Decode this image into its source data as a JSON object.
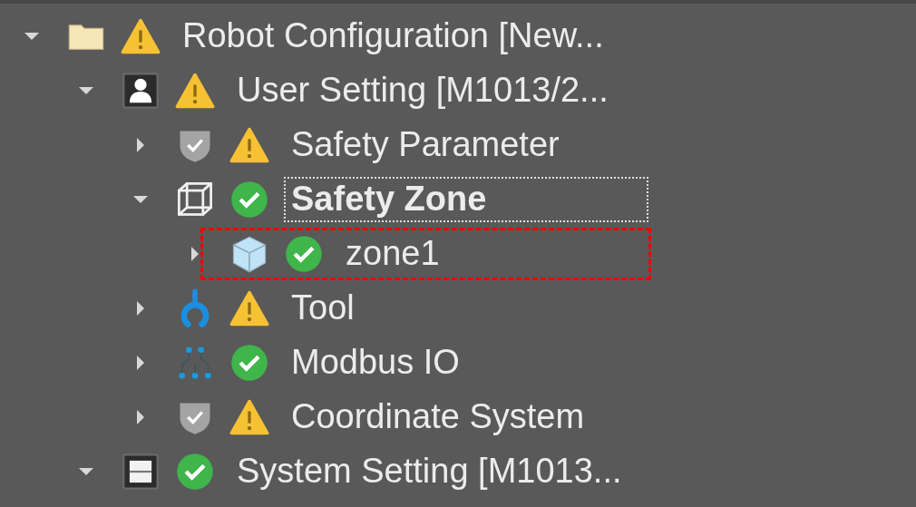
{
  "tree": [
    {
      "label": "Robot Configuration [New...",
      "kind": "folder",
      "warning": true,
      "expanded": true,
      "selected": false,
      "marked": false,
      "children": [
        {
          "label": "User Setting [M1013/2...",
          "kind": "user",
          "warning": true,
          "expanded": true,
          "selected": false,
          "marked": false,
          "children": [
            {
              "label": "Safety Parameter",
              "kind": "shield",
              "warning": true,
              "expanded": false,
              "selected": false,
              "marked": false
            },
            {
              "label": "Safety Zone",
              "kind": "zone",
              "warning": false,
              "expanded": true,
              "selected": true,
              "marked": false,
              "children": [
                {
                  "label": "zone1",
                  "kind": "cube",
                  "warning": false,
                  "expanded": false,
                  "selected": false,
                  "marked": true
                }
              ]
            },
            {
              "label": "Tool",
              "kind": "tool",
              "warning": true,
              "expanded": false,
              "selected": false,
              "marked": false
            },
            {
              "label": "Modbus IO",
              "kind": "modbus",
              "warning": false,
              "expanded": false,
              "selected": false,
              "marked": false
            },
            {
              "label": "Coordinate System",
              "kind": "shield",
              "warning": true,
              "expanded": false,
              "selected": false,
              "marked": false
            }
          ]
        },
        {
          "label": "System Setting [M1013...",
          "kind": "system",
          "warning": false,
          "expanded": true,
          "selected": false,
          "marked": false
        }
      ]
    }
  ]
}
